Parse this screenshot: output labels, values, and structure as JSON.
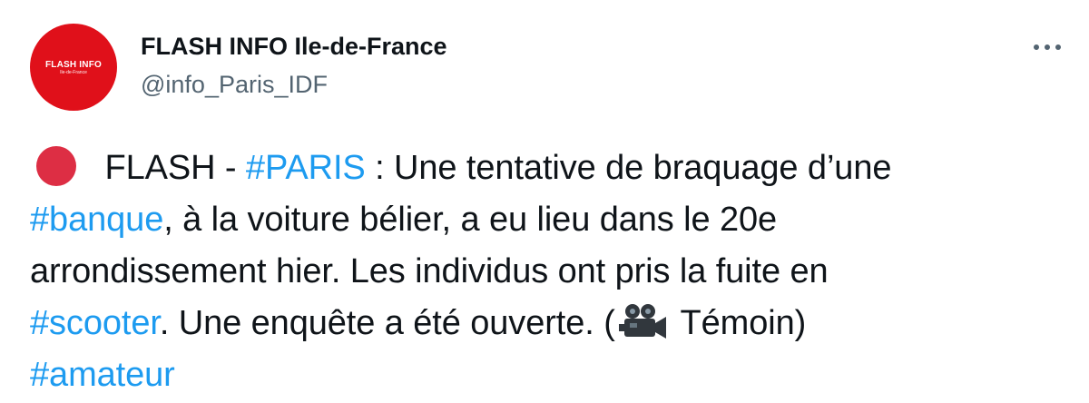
{
  "account": {
    "avatar_title": "FLASH INFO",
    "avatar_subtitle": "Ile-de-France",
    "display_name": "FLASH INFO Ile-de-France",
    "handle": "@info_Paris_IDF"
  },
  "colors": {
    "avatar_bg": "#e0101a",
    "hashtag": "#1d9bf0",
    "text": "#0f1419",
    "secondary_text": "#536471",
    "red_circle": "#dd2e44"
  },
  "icons": {
    "more": "more-horizontal-icon",
    "red_circle": "red-circle-emoji",
    "camera": "movie-camera-emoji"
  },
  "tweet": {
    "l1_prefix": " FLASH - ",
    "l1_tag": "#PARIS",
    "l1_rest": " : Une tentative de braquage d’une",
    "l2_tag": "#banque",
    "l2_rest": ", à la voiture bélier, a eu lieu dans le 20e",
    "l3": "arrondissement hier. Les individus ont pris la fuite en",
    "l4_tag": "#scooter",
    "l4_rest": ". Une enquête a été ouverte. (",
    "l4_after_camera": " Témoin)",
    "l5_tag": "#amateur"
  }
}
